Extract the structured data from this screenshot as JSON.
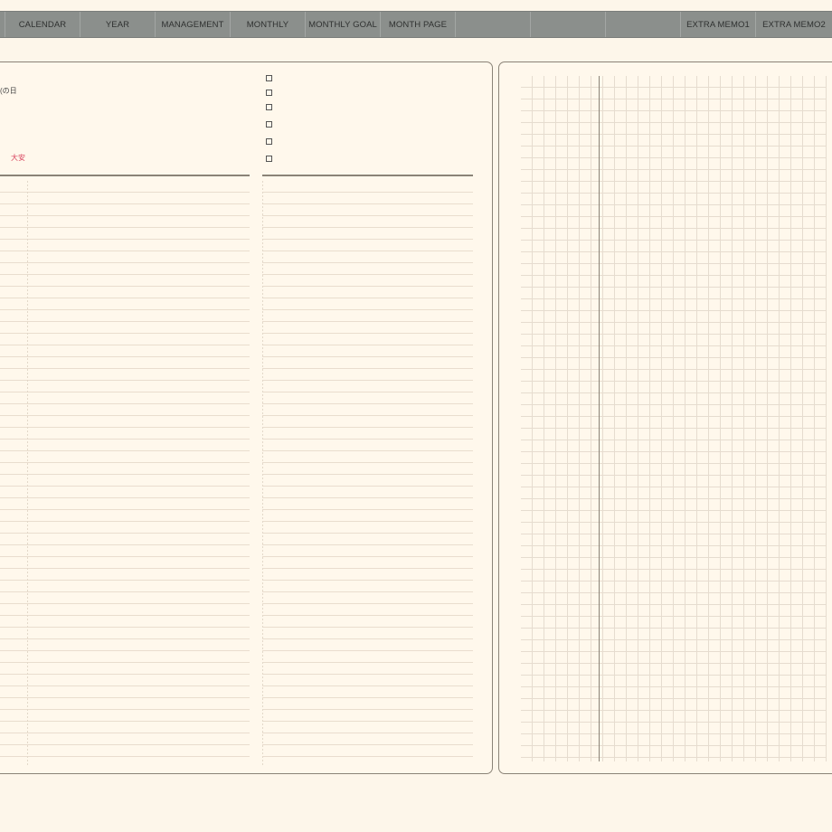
{
  "nav": {
    "tabs": [
      {
        "label": "CALENDAR"
      },
      {
        "label": "YEAR"
      },
      {
        "label": "MANAGEMENT"
      },
      {
        "label": "MONTHLY"
      },
      {
        "label": "MONTHLY GOAL"
      },
      {
        "label": "MONTH PAGE"
      },
      {
        "label": ""
      },
      {
        "label": ""
      },
      {
        "label": ""
      },
      {
        "label": "EXTRA MEMO1"
      },
      {
        "label": "EXTRA MEMO2"
      }
    ]
  },
  "left_page": {
    "day_note": "(の日",
    "holiday_label": "大安",
    "holiday_color": "#d9455f",
    "checkbox_count": 6
  },
  "colors": {
    "background": "#fdf6ea",
    "nav_bar": "#8b8f8c",
    "border": "#8a8377"
  }
}
